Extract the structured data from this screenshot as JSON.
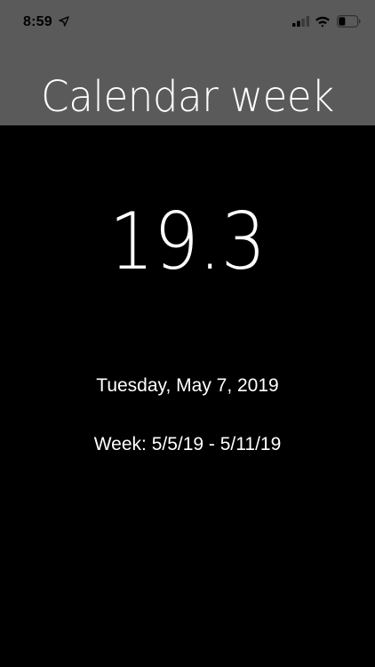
{
  "status_bar": {
    "time": "8:59",
    "icons": [
      "location-arrow-icon",
      "cellular-signal-icon",
      "wifi-icon",
      "battery-icon"
    ]
  },
  "header": {
    "title": "Calendar week",
    "background_color": "#5a5a5a"
  },
  "main": {
    "week_number": "19.3",
    "date": "Tuesday, May 7, 2019",
    "week_range": "Week: 5/5/19 - 5/11/19",
    "background_color": "#000000",
    "text_color": "#ffffff"
  }
}
